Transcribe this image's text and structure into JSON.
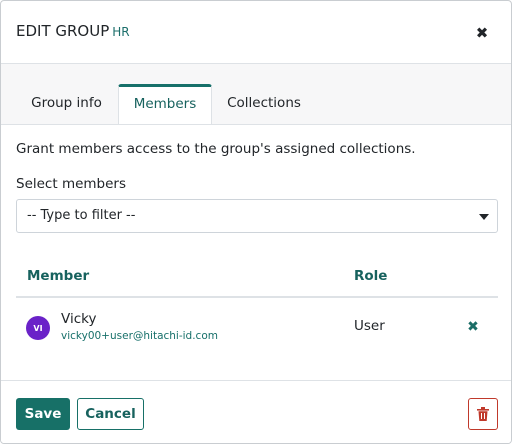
{
  "dialog": {
    "title": "EDIT GROUP",
    "group_name": "HR",
    "close_icon": "close-icon"
  },
  "tabs": [
    {
      "label": "Group info",
      "active": false
    },
    {
      "label": "Members",
      "active": true
    },
    {
      "label": "Collections",
      "active": false
    }
  ],
  "members_panel": {
    "description": "Grant members access to the group's assigned collections.",
    "select_label": "Select members",
    "select_placeholder": "-- Type to filter --",
    "table": {
      "headers": {
        "member": "Member",
        "role": "Role"
      },
      "rows": [
        {
          "avatar_initials": "VI",
          "name": "Vicky",
          "email": "vicky00+user@hitachi-id.com",
          "role": "User"
        }
      ]
    }
  },
  "footer": {
    "save_label": "Save",
    "cancel_label": "Cancel",
    "delete_icon": "trash-icon"
  },
  "colors": {
    "accent": "#177067",
    "avatar": "#6a22c8",
    "danger": "#c0392b"
  }
}
